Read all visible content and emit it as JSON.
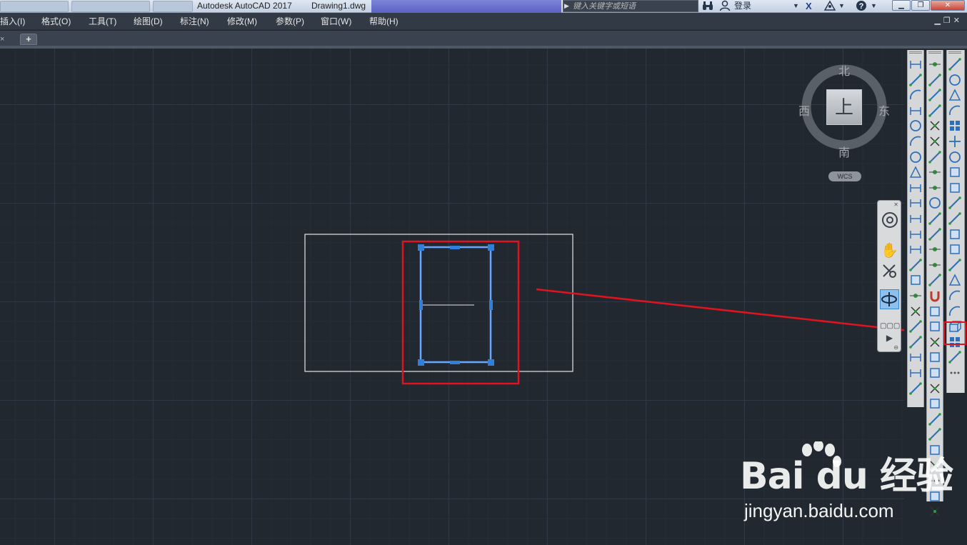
{
  "titlebar": {
    "app_title": "Autodesk AutoCAD 2017",
    "doc_title": "Drawing1.dwg",
    "login_label": "登录",
    "search_placeholder": "键入关键字或短语",
    "icons": [
      "binoculars-icon",
      "user-icon",
      "exchange-x-icon",
      "autodesk-a360-icon",
      "help-icon"
    ],
    "window_buttons": [
      "minimize",
      "restore",
      "close"
    ]
  },
  "menubar": {
    "items": [
      {
        "label": "插入(I)"
      },
      {
        "label": "格式(O)"
      },
      {
        "label": "工具(T)"
      },
      {
        "label": "绘图(D)"
      },
      {
        "label": "标注(N)"
      },
      {
        "label": "修改(M)"
      },
      {
        "label": "参数(P)"
      },
      {
        "label": "窗口(W)"
      },
      {
        "label": "帮助(H)"
      }
    ]
  },
  "tabs": {
    "new_tab_label": "+",
    "close_glyph": "×"
  },
  "viewcube": {
    "north": "北",
    "south": "南",
    "east": "东",
    "west": "西",
    "face": "上",
    "ucs_badge": "WCS"
  },
  "navbar": {
    "tools": [
      "steering-wheel-icon",
      "pan-hand-icon",
      "zoom-extents-icon",
      "orbit-icon",
      "viewcube-toggle-icon",
      "showmotion-icon"
    ]
  },
  "watermark": {
    "logo": "Bai du 经验",
    "site": "jingyan.baidu.com"
  },
  "colors": {
    "canvas": "#212830",
    "grip_blue": "#2f7fdb",
    "selection_line": "#6aa6ff",
    "annotation_red": "#e0141e",
    "drawing_white": "#e6e6e6"
  }
}
